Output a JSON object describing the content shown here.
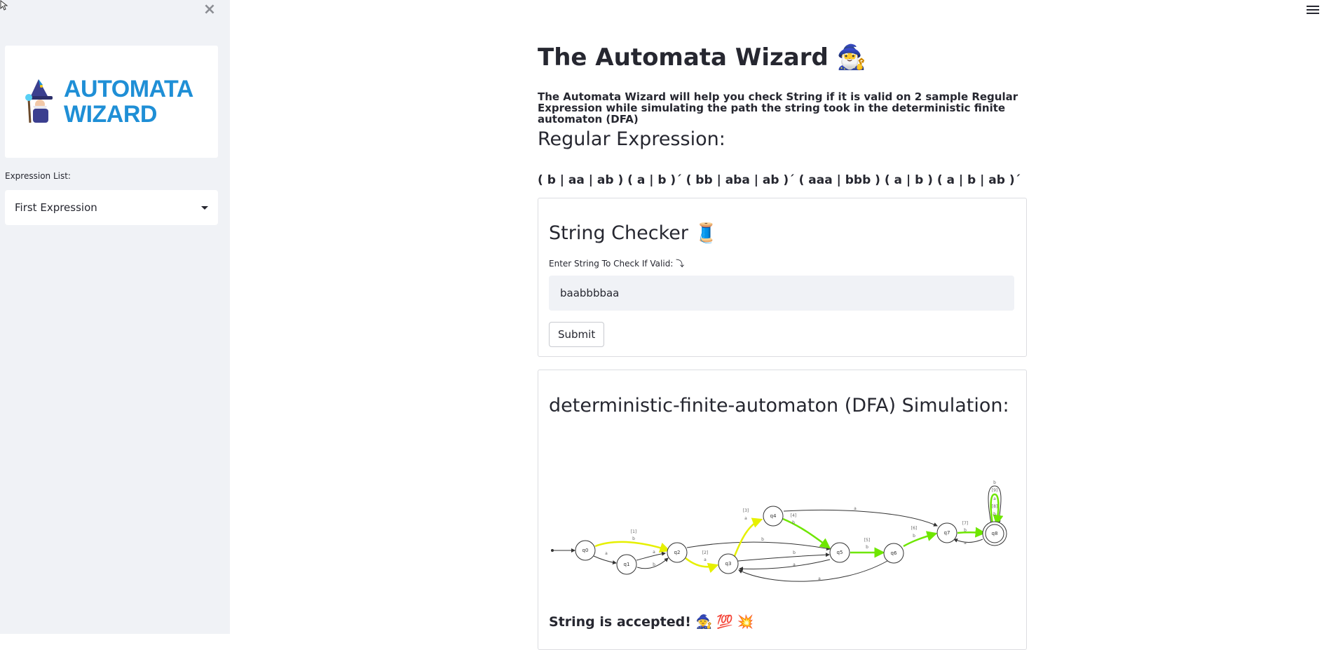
{
  "sidebar": {
    "logo": {
      "line1": "AUTOMATA",
      "line2": "WIZARD"
    },
    "expression_label": "Expression List:",
    "expression_selected": "First Expression"
  },
  "main": {
    "title": "The Automata Wizard",
    "title_emoji": "🧙‍♂️",
    "description": "The Automata Wizard will help you check String if it is valid on 2 sample Regular Expression while simulating the path the string took in the deterministic finite automaton (DFA)",
    "regex_heading": "Regular Expression:",
    "regex": "( b | aa | ab ) ( a | b )´ ( bb | aba | ab )´ ( aaa | bbb ) ( a | b ) ( a | b | ab )´",
    "checker": {
      "title": "String Checker",
      "title_emoji": "🧵",
      "input_label": "Enter String To Check If Valid: ⤵",
      "input_value": "baabbbbaa",
      "submit_label": "Submit"
    },
    "dfa": {
      "title": "deterministic-finite-automaton (DFA) Simulation:",
      "result": "String is accepted!",
      "result_emojis": "🧙 💯 💥",
      "states": [
        "q0",
        "q1",
        "q2",
        "q3",
        "q4",
        "q5",
        "q6",
        "q7",
        "q8"
      ],
      "edge_labels": {
        "q0_q2": [
          "[1]",
          "b"
        ],
        "q0_q1": [
          "a"
        ],
        "q1_q2a": [
          "a"
        ],
        "q1_q2b": [
          "b"
        ],
        "q2_q3": [
          "[2]",
          "a"
        ],
        "q2_q5": [
          "b"
        ],
        "q3_q4": [
          "[3]",
          "a"
        ],
        "q3_q5": [
          "b"
        ],
        "q5_q3": [
          "a"
        ],
        "q4_q5": [
          "[4]",
          "b"
        ],
        "q5_q6": [
          "[5]",
          "b"
        ],
        "q6_q3": [
          "a"
        ],
        "q6_q7": [
          "[6]",
          "b"
        ],
        "q4_q7": [
          "a"
        ],
        "q7_q8": [
          "[7]",
          "b"
        ],
        "q8_q7": [
          "a"
        ],
        "q8_loop": [
          "b",
          "[9]",
          "a",
          "[8]",
          "b"
        ]
      }
    }
  },
  "colors": {
    "path_yellow": "#e6f000",
    "path_green": "#6ee600",
    "accent_blue": "#1f8fd6"
  }
}
